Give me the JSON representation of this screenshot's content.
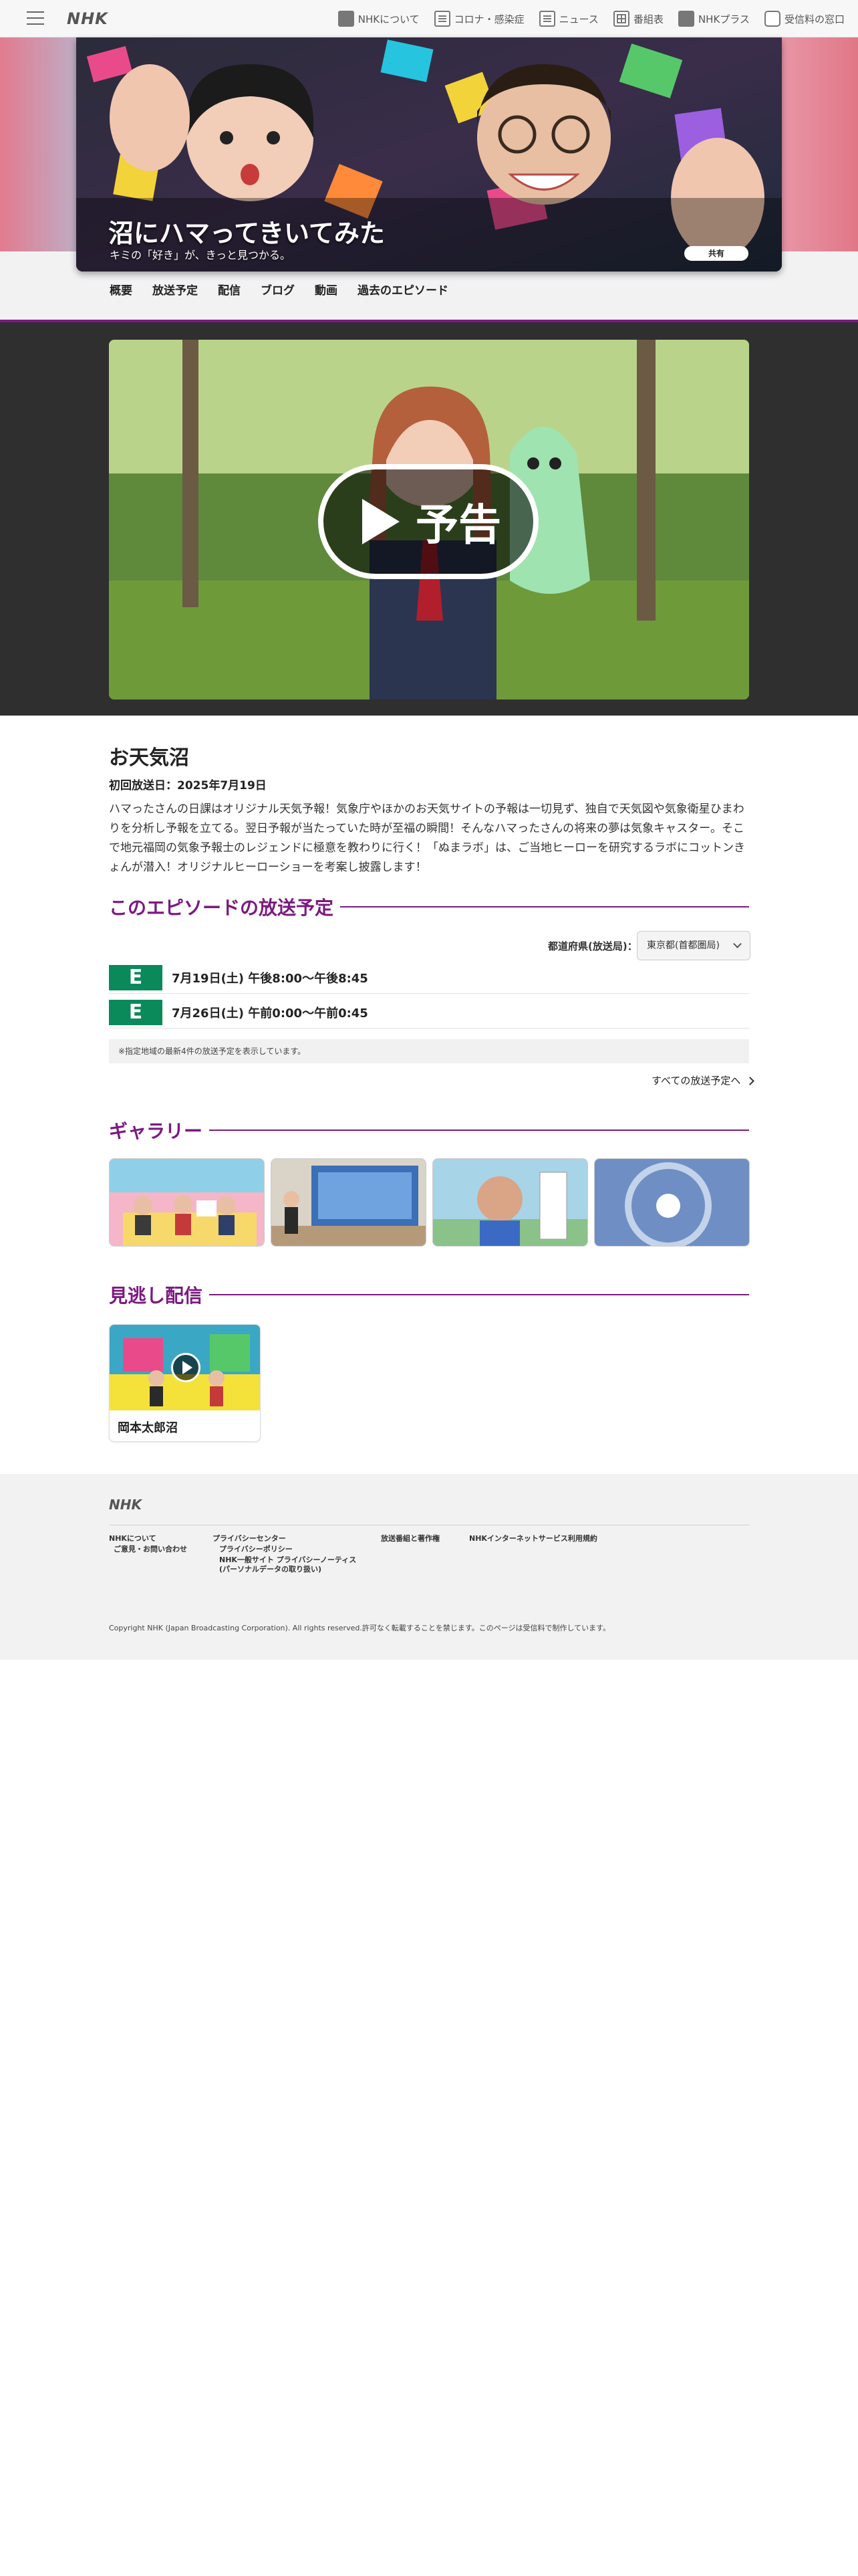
{
  "global_nav": {
    "logo": "NHK",
    "items": [
      {
        "label": "NHKについて",
        "icon": "nhk-box-icon"
      },
      {
        "label": "コロナ・感染症",
        "icon": "corona-icon"
      },
      {
        "label": "ニュース",
        "icon": "news-icon"
      },
      {
        "label": "番組表",
        "icon": "program-table-icon"
      },
      {
        "label": "NHKプラス",
        "icon": "nhk-plus-icon"
      },
      {
        "label": "受信料の窓口",
        "icon": "tv-icon"
      }
    ]
  },
  "hero": {
    "title": "沼にハマってきいてみた",
    "subtitle": "キミの「好き」が、きっと見つかる。",
    "share_label": "共有"
  },
  "program_nav": [
    "概要",
    "放送予定",
    "配信",
    "ブログ",
    "動画",
    "過去のエピソード"
  ],
  "video": {
    "play_label": "予告"
  },
  "episode": {
    "title": "お天気沼",
    "first_air": "初回放送日：2025年7月19日",
    "description": "ハマったさんの日課はオリジナル天気予報！気象庁やほかのお天気サイトの予報は一切見ず、独自で天気図や気象衛星ひまわりを分析し予報を立てる。翌日予報が当たっていた時が至福の瞬間！そんなハマったさんの将来の夢は気象キャスター。そこで地元福岡の気象予報士のレジェンドに極意を教わりに行く！「ぬまラボ」は、ご当地ヒーローを研究するラボにコットンきょんが潜入！オリジナルヒーローショーを考案し披露します！"
  },
  "schedule": {
    "heading": "このエピソードの放送予定",
    "region_label": "都道府県(放送局)：",
    "region_value": "東京都(首都圏局)",
    "rows": [
      {
        "channel": "E",
        "time": "7月19日(土) 午後8:00〜午後8:45"
      },
      {
        "channel": "E",
        "time": "7月26日(土) 午前0:00〜午前0:45"
      }
    ],
    "note": "※指定地域の最新4件の放送予定を表示しています。",
    "all_link": "すべての放送予定へ",
    "channel_color": "#0a8a5a"
  },
  "gallery": {
    "heading": "ギャラリー"
  },
  "missed": {
    "heading": "見逃し配信",
    "card_label": "岡本太郎沼"
  },
  "footer": {
    "logo": "NHK",
    "links": {
      "about": "NHKについて",
      "contact": "ご意見・お問い合わせ",
      "privacy_center": "プライバシーセンター",
      "privacy_policy": "プライバシーポリシー",
      "privacy_notice_1": "NHK一般サイト プライバシーノーティス",
      "privacy_notice_2": "(パーソナルデータの取り扱い)",
      "copyright_rights": "放送番組と著作権",
      "terms": "NHKインターネットサービス利用規約"
    },
    "copyright": "Copyright NHK (Japan Broadcasting Corporation). All rights reserved.許可なく転載することを禁じます。このページは受信料で制作しています。"
  },
  "colors": {
    "accent": "#7b1a80",
    "channel_e": "#0a8a5a"
  }
}
